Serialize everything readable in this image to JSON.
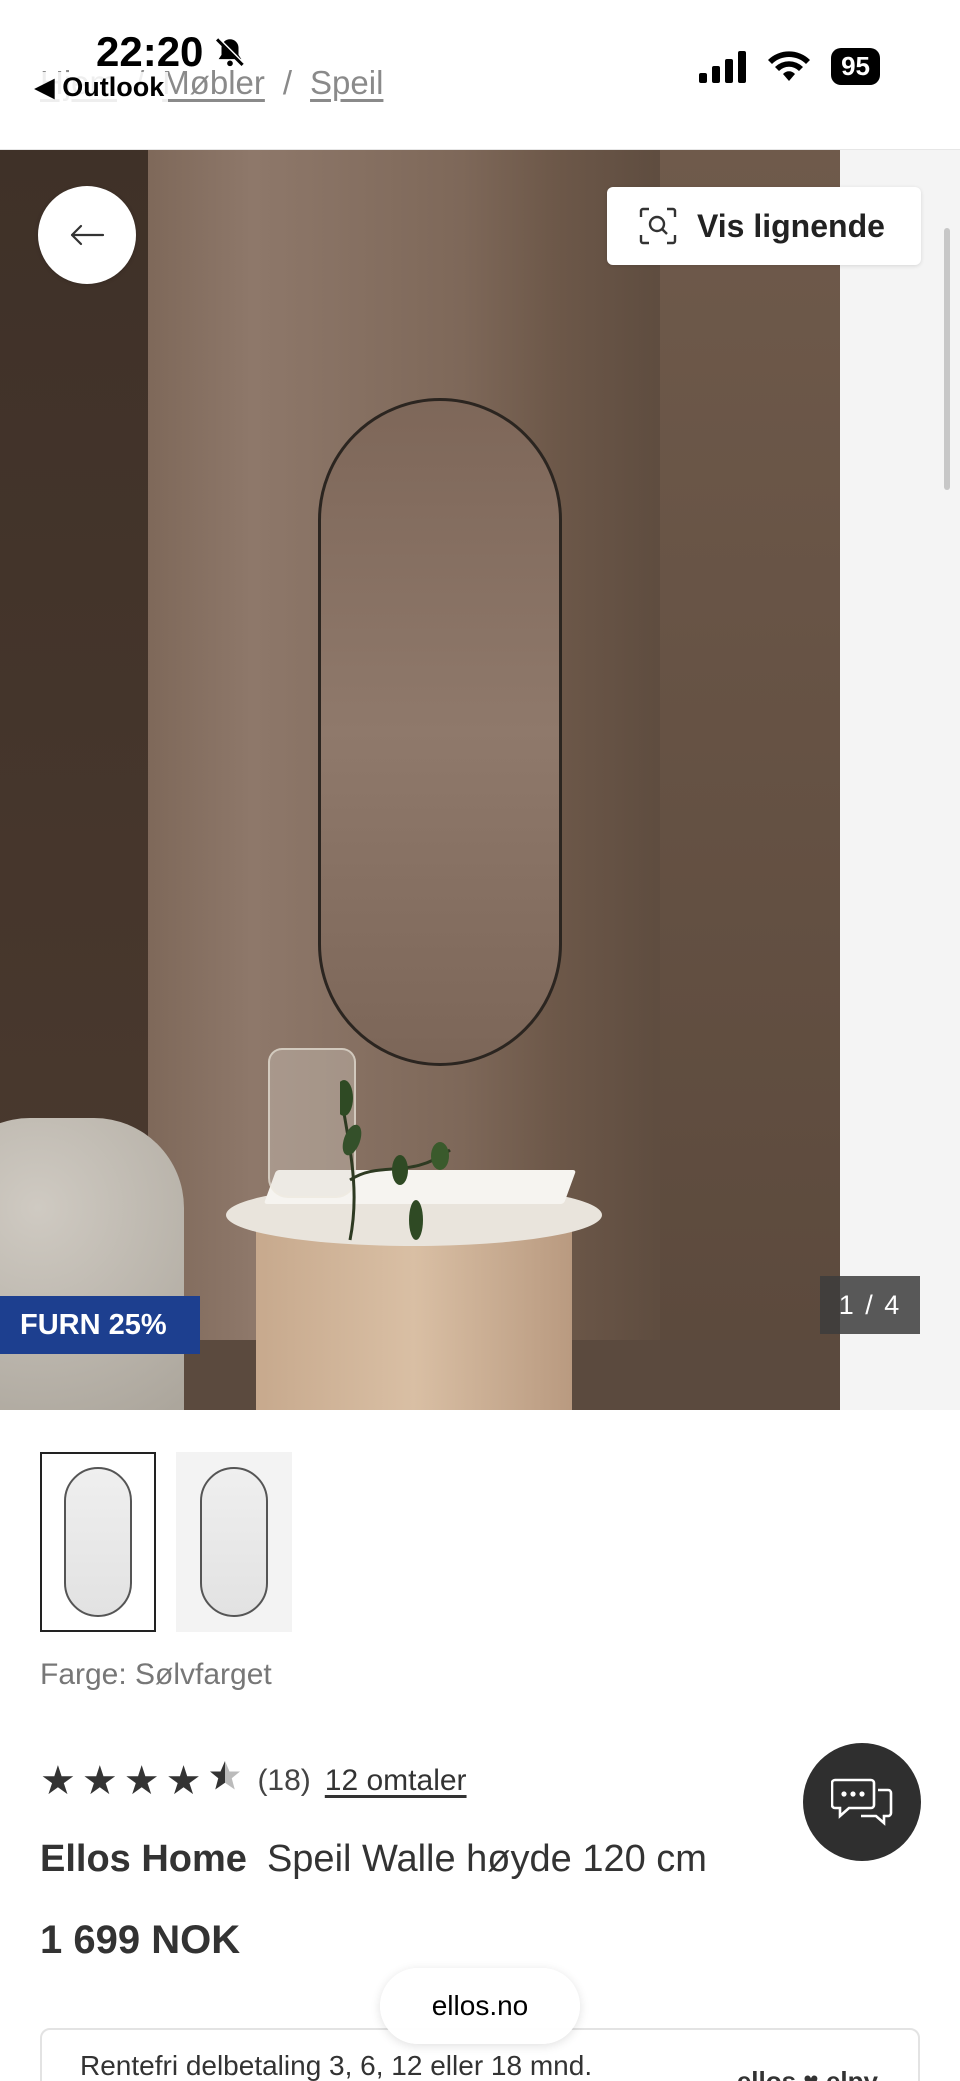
{
  "status_bar": {
    "time": "22:20",
    "back_app": "◀ Outlook",
    "battery": "95"
  },
  "breadcrumb": {
    "items": [
      "Hjem",
      "Møbler",
      "Speil"
    ],
    "separator": "/"
  },
  "hero": {
    "vis_lignende_label": "Vis lignende",
    "promo_badge": "FURN 25%",
    "counter": "1 / 4",
    "promo_color": "#1d3f8f"
  },
  "product": {
    "color_label": "Farge: Sølvfarget",
    "rating_value": 4.5,
    "rating_count": "(18)",
    "reviews_link": "12 omtaler",
    "brand": "Ellos Home",
    "name": "Speil Walle høyde 120 cm",
    "price": "1 699 NOK"
  },
  "browser": {
    "url": "ellos.no"
  },
  "finance": {
    "text": "Rentefri delbetaling 3, 6, 12 eller 18 mnd.",
    "logo": "ellos ♥ elpy"
  }
}
